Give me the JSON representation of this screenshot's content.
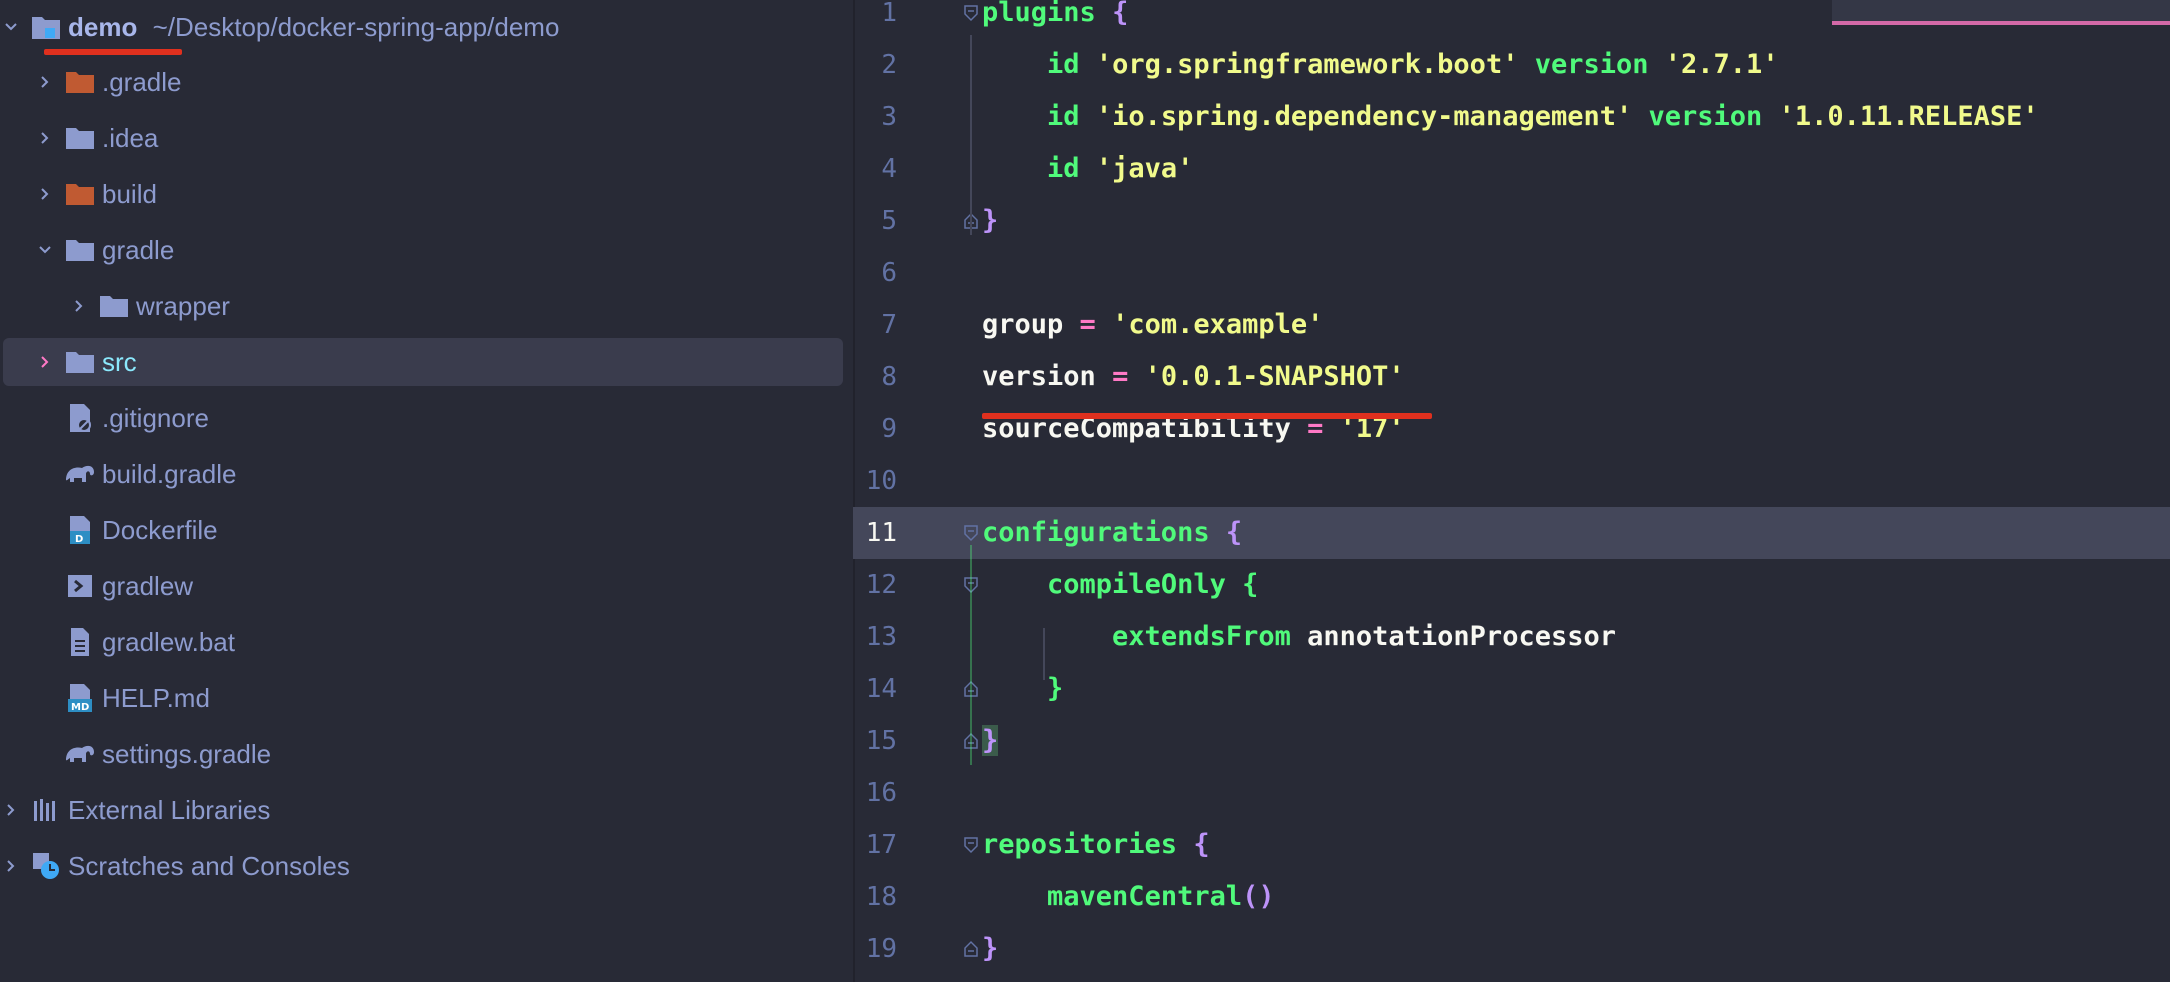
{
  "project_tree": {
    "root": {
      "name": "demo",
      "path": "~/Desktop/docker-spring-app/demo"
    },
    "items": [
      {
        "label": ".gradle",
        "icon": "folder-excluded-icon",
        "expanded": false
      },
      {
        "label": ".idea",
        "icon": "folder-icon",
        "expanded": false
      },
      {
        "label": "build",
        "icon": "folder-excluded-icon",
        "expanded": false
      },
      {
        "label": "gradle",
        "icon": "folder-icon",
        "expanded": true
      },
      {
        "label": "wrapper",
        "icon": "folder-icon",
        "expanded": false
      },
      {
        "label": "src",
        "icon": "folder-icon",
        "expanded": false,
        "selected": true
      },
      {
        "label": ".gitignore",
        "icon": "gitignore-file-icon"
      },
      {
        "label": "build.gradle",
        "icon": "gradle-elephant-icon"
      },
      {
        "label": "Dockerfile",
        "icon": "docker-file-icon"
      },
      {
        "label": "gradlew",
        "icon": "shell-script-icon"
      },
      {
        "label": "gradlew.bat",
        "icon": "text-file-icon"
      },
      {
        "label": "HELP.md",
        "icon": "markdown-file-icon"
      },
      {
        "label": "settings.gradle",
        "icon": "gradle-elephant-icon"
      }
    ],
    "external_libraries": "External Libraries",
    "scratches": "Scratches and Consoles"
  },
  "editor": {
    "current_line": 11,
    "lines": [
      {
        "n": "1",
        "tokens": [
          [
            "kw",
            "plugins"
          ],
          [
            "plain",
            " "
          ],
          [
            "br",
            "{"
          ]
        ]
      },
      {
        "n": "2",
        "tokens": [
          [
            "plain",
            "    "
          ],
          [
            "kw",
            "id"
          ],
          [
            "plain",
            " "
          ],
          [
            "str",
            "'org.springframework.boot'"
          ],
          [
            "plain",
            " "
          ],
          [
            "kw",
            "version"
          ],
          [
            "plain",
            " "
          ],
          [
            "str",
            "'2.7.1'"
          ]
        ]
      },
      {
        "n": "3",
        "tokens": [
          [
            "plain",
            "    "
          ],
          [
            "kw",
            "id"
          ],
          [
            "plain",
            " "
          ],
          [
            "str",
            "'io.spring.dependency-management'"
          ],
          [
            "plain",
            " "
          ],
          [
            "kw",
            "version"
          ],
          [
            "plain",
            " "
          ],
          [
            "str",
            "'1.0.11.RELEASE'"
          ]
        ]
      },
      {
        "n": "4",
        "tokens": [
          [
            "plain",
            "    "
          ],
          [
            "kw",
            "id"
          ],
          [
            "plain",
            " "
          ],
          [
            "str",
            "'java'"
          ]
        ]
      },
      {
        "n": "5",
        "tokens": [
          [
            "br",
            "}"
          ]
        ]
      },
      {
        "n": "6",
        "tokens": []
      },
      {
        "n": "7",
        "tokens": [
          [
            "plain",
            "group"
          ],
          [
            "plain",
            " "
          ],
          [
            "op",
            "="
          ],
          [
            "plain",
            " "
          ],
          [
            "str",
            "'com.example'"
          ]
        ]
      },
      {
        "n": "8",
        "tokens": [
          [
            "plain",
            "version"
          ],
          [
            "plain",
            " "
          ],
          [
            "op",
            "="
          ],
          [
            "plain",
            " "
          ],
          [
            "str",
            "'0.0.1-SNAPSHOT'"
          ]
        ]
      },
      {
        "n": "9",
        "tokens": [
          [
            "plain",
            "sourceCompatibility"
          ],
          [
            "plain",
            " "
          ],
          [
            "op",
            "="
          ],
          [
            "plain",
            " "
          ],
          [
            "str",
            "'17'"
          ]
        ]
      },
      {
        "n": "10",
        "tokens": []
      },
      {
        "n": "11",
        "tokens": [
          [
            "kw",
            "configurations"
          ],
          [
            "plain",
            " "
          ],
          [
            "br",
            "{"
          ]
        ]
      },
      {
        "n": "12",
        "tokens": [
          [
            "plain",
            "    "
          ],
          [
            "kw",
            "compileOnly"
          ],
          [
            "plain",
            " "
          ],
          [
            "kw",
            "{"
          ]
        ]
      },
      {
        "n": "13",
        "tokens": [
          [
            "plain",
            "        "
          ],
          [
            "kw",
            "extendsFrom"
          ],
          [
            "plain",
            " "
          ],
          [
            "plain",
            "annotationProcessor"
          ]
        ]
      },
      {
        "n": "14",
        "tokens": [
          [
            "plain",
            "    "
          ],
          [
            "kw",
            "}"
          ]
        ]
      },
      {
        "n": "15",
        "tokens": [
          [
            "br",
            "}"
          ]
        ]
      },
      {
        "n": "16",
        "tokens": []
      },
      {
        "n": "17",
        "tokens": [
          [
            "kw",
            "repositories"
          ],
          [
            "plain",
            " "
          ],
          [
            "br",
            "{"
          ]
        ]
      },
      {
        "n": "18",
        "tokens": [
          [
            "plain",
            "    "
          ],
          [
            "kw",
            "mavenCentral"
          ],
          [
            "br",
            "()"
          ]
        ]
      },
      {
        "n": "19",
        "tokens": [
          [
            "br",
            "}"
          ]
        ]
      }
    ]
  },
  "colors": {
    "background": "#282a36",
    "keyword": "#50fa7b",
    "string": "#f1fa8c",
    "operator": "#ff79c6",
    "brace": "#bd93f9",
    "annotation_underline": "#e0301e"
  }
}
